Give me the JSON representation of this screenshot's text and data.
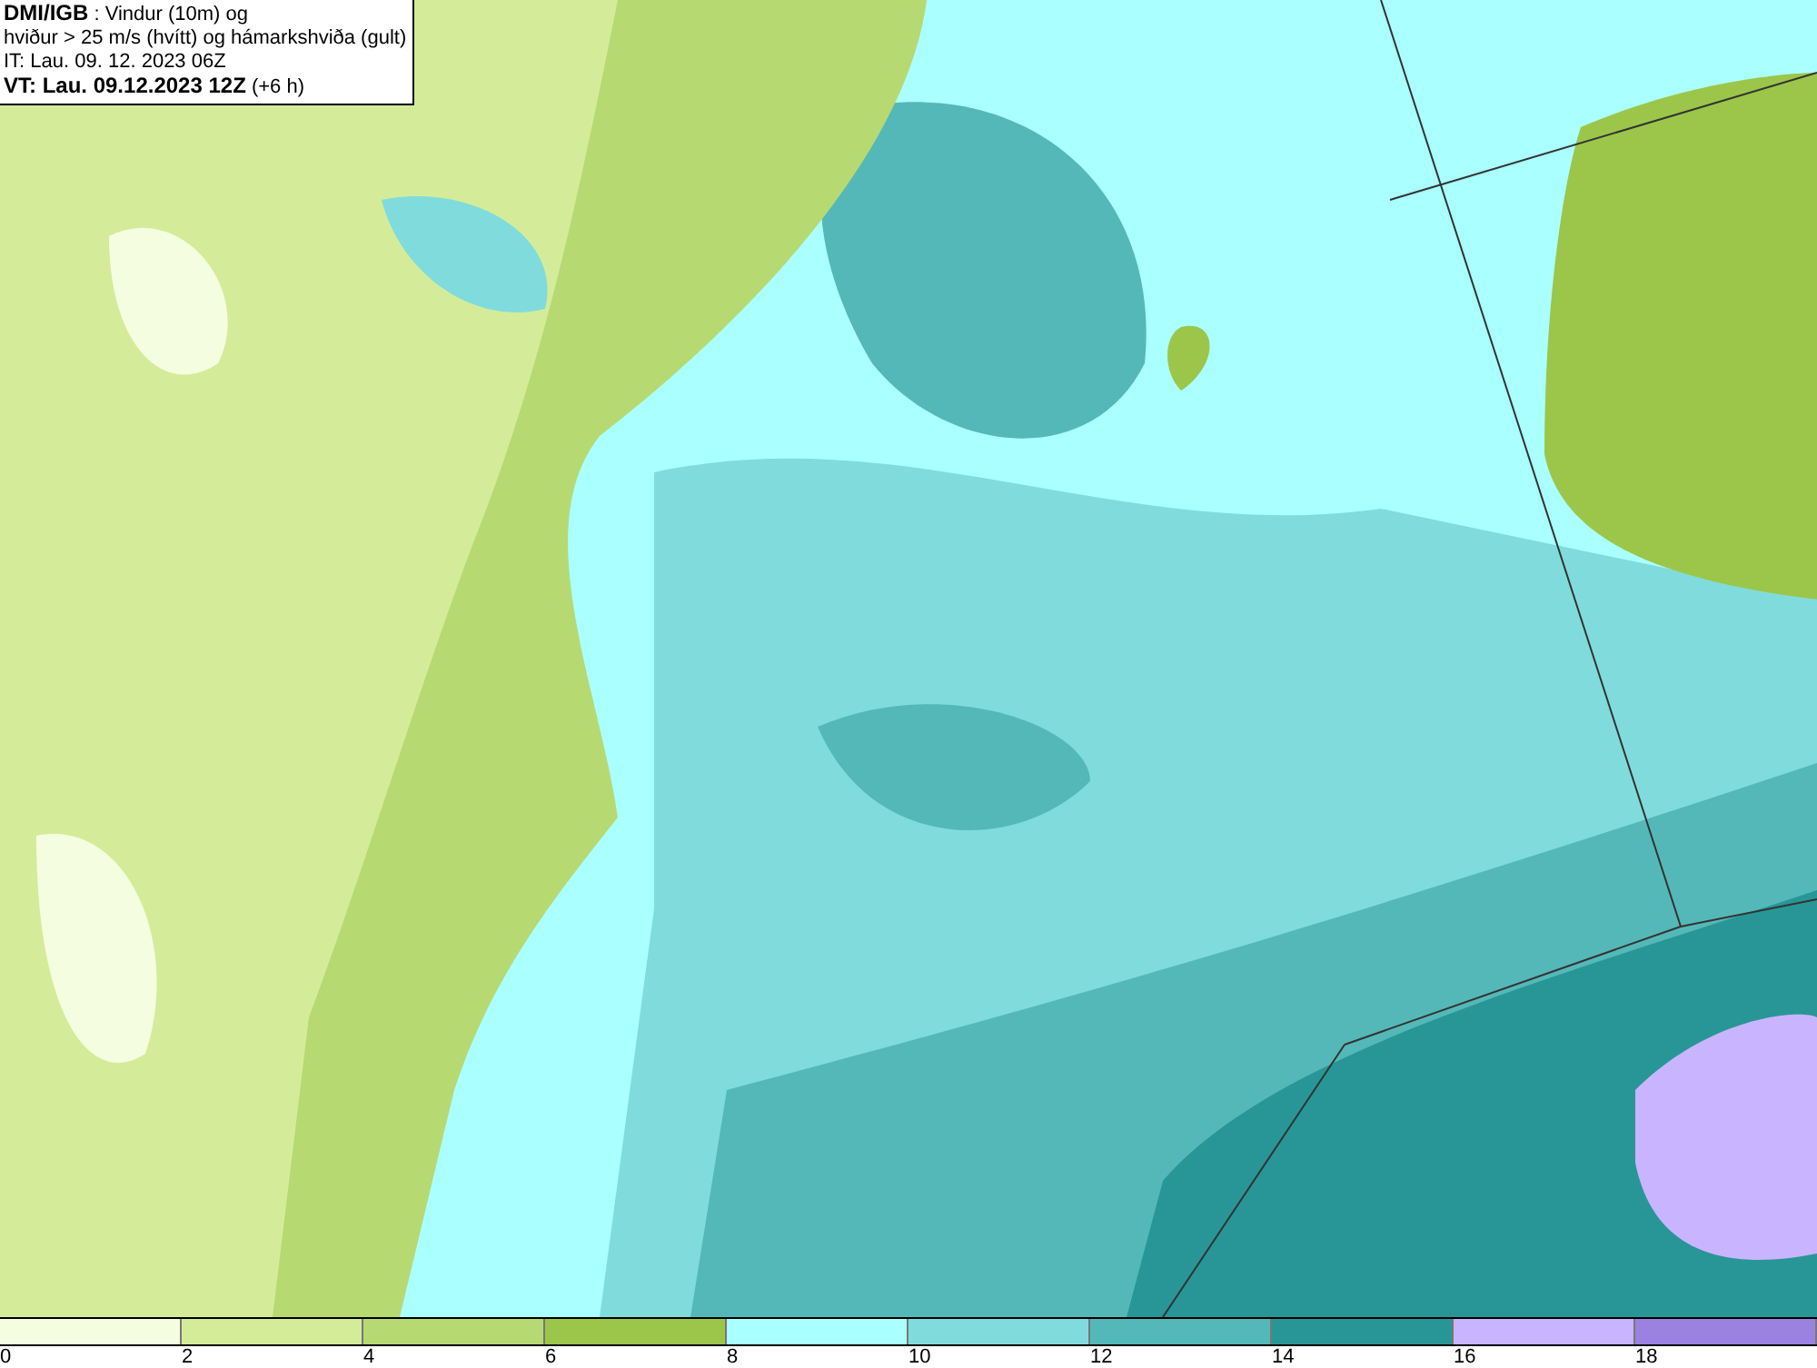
{
  "header": {
    "lines": [
      "**DMI/IGB** : Vindur (10m) og",
      "hviður > 25 m/s (hvítt) og hámarkshviða (gult)",
      "IT: Lau. 09. 12. 2023 06Z",
      "**VT: Lau. 09.12.2023 12Z** (+6 h)"
    ]
  },
  "legend": {
    "swatches": [
      {
        "color": "#f5fde0"
      },
      {
        "color": "#d4ec9a"
      },
      {
        "color": "#b6d972"
      },
      {
        "color": "#9cc64a"
      },
      {
        "color": "#aaffff"
      },
      {
        "color": "#80dcdc"
      },
      {
        "color": "#55b8b8"
      },
      {
        "color": "#289696"
      },
      {
        "color": "#c8b4ff"
      },
      {
        "color": "#9b82e0"
      }
    ],
    "labels": [
      "0",
      "2",
      "4",
      "6",
      "8",
      "10",
      "12",
      "14",
      "16",
      "18"
    ]
  }
}
